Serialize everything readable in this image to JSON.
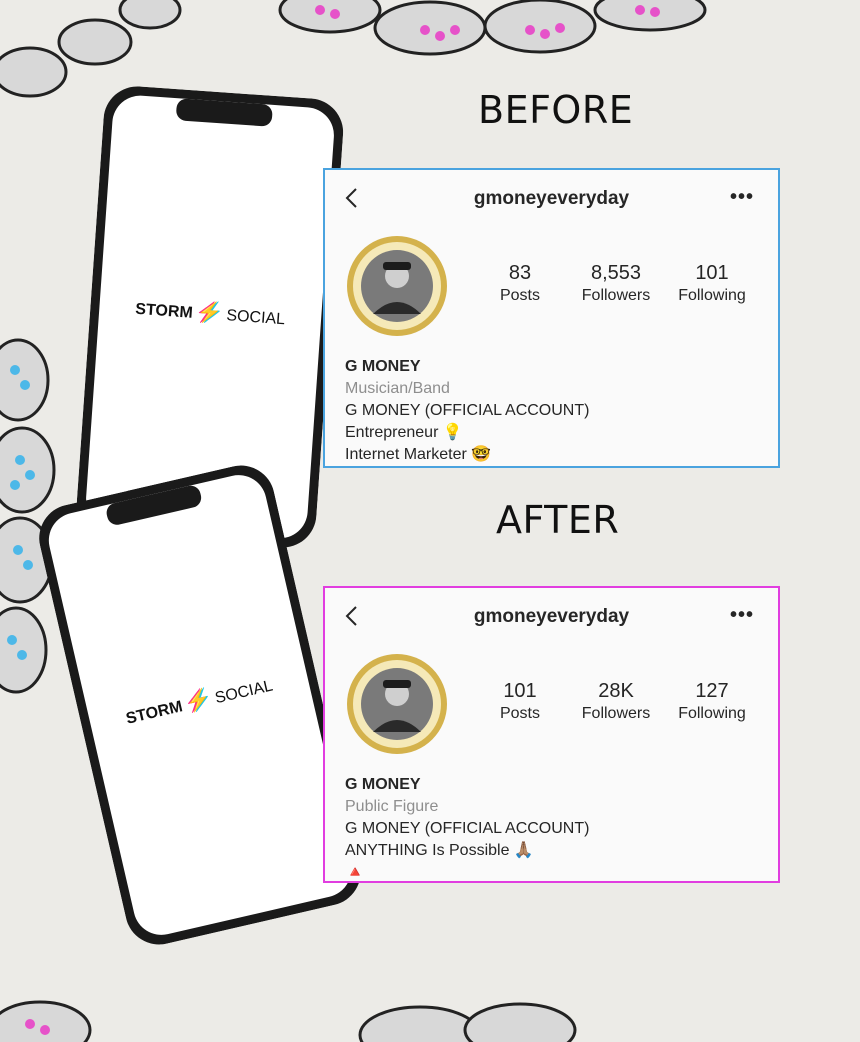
{
  "headings": {
    "before": "BEFORE",
    "after": "AFTER"
  },
  "logo": {
    "left": "STORM",
    "right": "SOCIAL"
  },
  "icons": {
    "back": "chevron-left-icon",
    "more": "more-icon",
    "bulb": "lightbulb-emoji",
    "nerd": "nerd-face-emoji",
    "pray": "folded-hands-emoji",
    "triangle": "red-triangle-emoji"
  },
  "colors": {
    "before_border": "#4aa3df",
    "after_border": "#e13de0",
    "avatar_ring": "#d4b24c"
  },
  "before": {
    "username": "gmoneyeveryday",
    "more": "•••",
    "stats": [
      {
        "value": "83",
        "label": "Posts"
      },
      {
        "value": "8,553",
        "label": "Followers"
      },
      {
        "value": "101",
        "label": "Following"
      }
    ],
    "name": "G MONEY",
    "category": "Musician/Band",
    "bio": [
      "G MONEY (OFFICIAL ACCOUNT)",
      "Entrepreneur 💡",
      "Internet Marketer 🤓"
    ]
  },
  "after": {
    "username": "gmoneyeveryday",
    "more": "•••",
    "stats": [
      {
        "value": "101",
        "label": "Posts"
      },
      {
        "value": "28K",
        "label": "Followers"
      },
      {
        "value": "127",
        "label": "Following"
      }
    ],
    "name": "G MONEY",
    "category": "Public Figure",
    "bio": [
      "G MONEY (OFFICIAL ACCOUNT)",
      "ANYTHING Is Possible 🙏🏽",
      "🔺"
    ]
  }
}
